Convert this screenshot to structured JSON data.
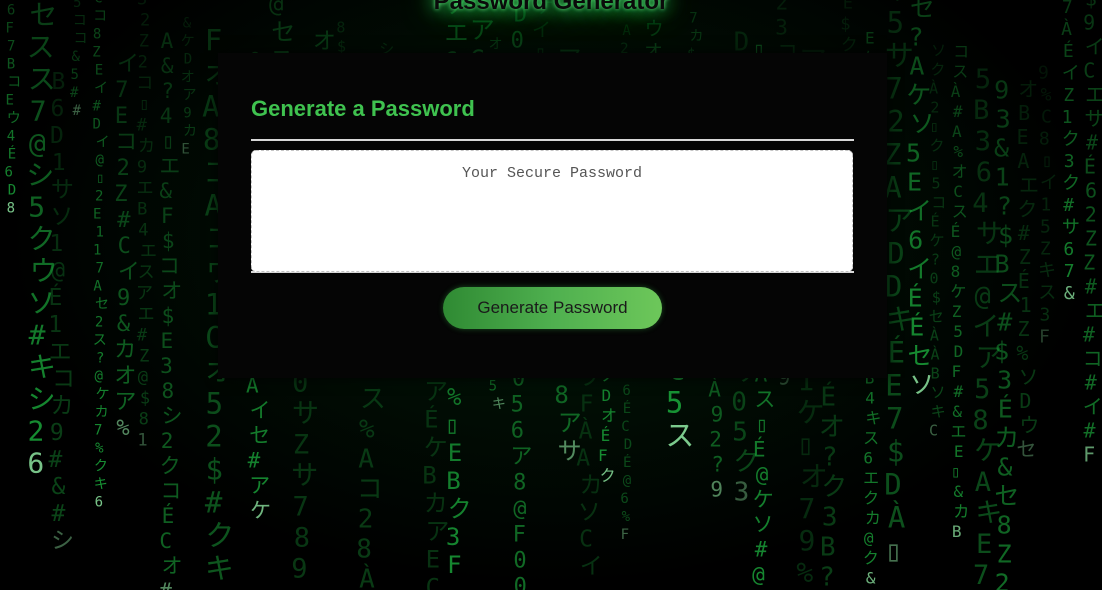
{
  "header": {
    "title": "Password Generator"
  },
  "card": {
    "title": "Generate a Password",
    "password_field": {
      "placeholder": "Your Secure Password",
      "value": ""
    },
    "generate_button_label": "Generate Password"
  },
  "theme": {
    "accent": "#3fc24f",
    "button_gradient_start": "#2f8a33",
    "button_gradient_end": "#6dc75a",
    "background": "#000000",
    "card_background": "#050505",
    "matrix_green": "#1fbf44"
  },
  "background_image": {
    "icon": "matrix-code-rain"
  }
}
